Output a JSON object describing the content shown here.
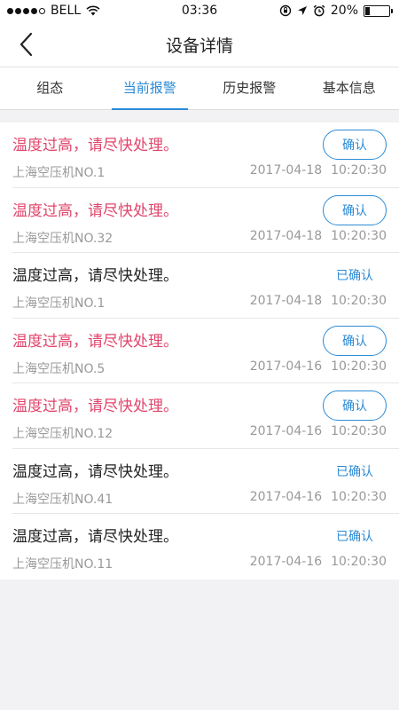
{
  "status_bar": {
    "carrier": "BELL",
    "time": "03:36",
    "battery": "20%",
    "battery_level": 0.2
  },
  "header": {
    "title": "设备详情"
  },
  "tabs": [
    {
      "label": "组态",
      "active": false
    },
    {
      "label": "当前报警",
      "active": true
    },
    {
      "label": "历史报警",
      "active": false
    },
    {
      "label": "基本信息",
      "active": false
    }
  ],
  "confirm_label": "确认",
  "confirmed_label": "已确认",
  "alarms": [
    {
      "message": "温度过高，请尽快处理。",
      "device": "上海空压机NO.1",
      "date": "2017-04-18",
      "time": "10:20:30",
      "confirmed": false
    },
    {
      "message": "温度过高，请尽快处理。",
      "device": "上海空压机NO.32",
      "date": "2017-04-18",
      "time": "10:20:30",
      "confirmed": false
    },
    {
      "message": "温度过高，请尽快处理。",
      "device": "上海空压机NO.1",
      "date": "2017-04-18",
      "time": "10:20:30",
      "confirmed": true
    },
    {
      "message": "温度过高，请尽快处理。",
      "device": "上海空压机NO.5",
      "date": "2017-04-16",
      "time": "10:20:30",
      "confirmed": false
    },
    {
      "message": "温度过高，请尽快处理。",
      "device": "上海空压机NO.12",
      "date": "2017-04-16",
      "time": "10:20:30",
      "confirmed": false
    },
    {
      "message": "温度过高，请尽快处理。",
      "device": "上海空压机NO.41",
      "date": "2017-04-16",
      "time": "10:20:30",
      "confirmed": true
    },
    {
      "message": "温度过高，请尽快处理。",
      "device": "上海空压机NO.11",
      "date": "2017-04-16",
      "time": "10:20:30",
      "confirmed": true
    }
  ]
}
